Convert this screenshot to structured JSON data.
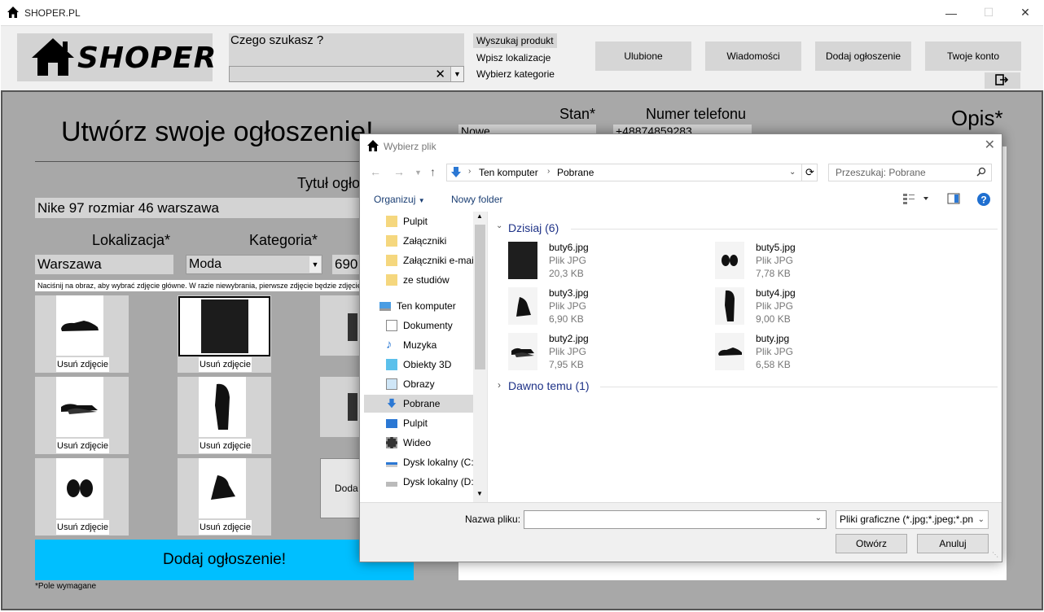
{
  "app": {
    "window_title": "SHOPER.PL",
    "logo_text": "SHOPER"
  },
  "header": {
    "search_query": "Czego szukasz ?",
    "search_product": "Wyszukaj produkt",
    "set_location": "Wpisz lokalizacje",
    "choose_category": "Wybierz kategorie",
    "nav": [
      "Ulubione",
      "Wiadomości",
      "Dodaj ogłoszenie",
      "Twoje konto"
    ]
  },
  "form": {
    "page_title": "Utwórz swoje ogłoszenie!",
    "title_label": "Tytuł ogło",
    "title_value": "Nike 97 rozmiar 46 warszawa",
    "location_label": "Lokalizacja*",
    "location_value": "Warszawa",
    "category_label": "Kategoria*",
    "category_value": "Moda",
    "price_value": "690",
    "state_label": "Stan*",
    "state_value": "Nowe",
    "phone_label": "Numer telefonu",
    "phone_value": "+48874859283",
    "description_label": "Opis*",
    "hint": "Naciśnij na obraz, aby wybrać zdjęcie główne. W razie niewybrania, pierwsze zdjęcie będzie zdjęciem głównym",
    "remove_photo": "Usuń zdjęcie",
    "add_photo": "Doda",
    "submit": "Dodaj ogłoszenie!",
    "required_note": "*Pole wymagane"
  },
  "dialog": {
    "title": "Wybierz plik",
    "breadcrumb": [
      "Ten komputer",
      "Pobrane"
    ],
    "search_placeholder": "Przeszukaj: Pobrane",
    "organize": "Organizuj",
    "new_folder": "Nowy folder",
    "nav_items": [
      {
        "label": "Pulpit",
        "icon": "folder-icon"
      },
      {
        "label": "Załączniki",
        "icon": "folder-icon"
      },
      {
        "label": "Załączniki e-mai",
        "icon": "folder-icon"
      },
      {
        "label": "ze studiów",
        "icon": "folder-icon"
      },
      {
        "label": "Ten komputer",
        "icon": "computer-icon"
      },
      {
        "label": "Dokumenty",
        "icon": "documents-icon"
      },
      {
        "label": "Muzyka",
        "icon": "music-icon"
      },
      {
        "label": "Obiekty 3D",
        "icon": "cube-icon"
      },
      {
        "label": "Obrazy",
        "icon": "pictures-icon"
      },
      {
        "label": "Pobrane",
        "icon": "download-icon"
      },
      {
        "label": "Pulpit",
        "icon": "desktop-icon"
      },
      {
        "label": "Wideo",
        "icon": "video-icon"
      },
      {
        "label": "Dysk lokalny (C:)",
        "icon": "drive-icon"
      },
      {
        "label": "Dysk lokalny (D:)",
        "icon": "drive-icon"
      }
    ],
    "group_today": "Dzisiaj (6)",
    "group_earlier": "Dawno temu (1)",
    "files": [
      {
        "name": "buty6.jpg",
        "type": "Plik JPG",
        "size": "20,3 KB"
      },
      {
        "name": "buty5.jpg",
        "type": "Plik JPG",
        "size": "7,78 KB"
      },
      {
        "name": "buty3.jpg",
        "type": "Plik JPG",
        "size": "6,90 KB"
      },
      {
        "name": "buty4.jpg",
        "type": "Plik JPG",
        "size": "9,00 KB"
      },
      {
        "name": "buty2.jpg",
        "type": "Plik JPG",
        "size": "7,95 KB"
      },
      {
        "name": "buty.jpg",
        "type": "Plik JPG",
        "size": "6,58 KB"
      }
    ],
    "filename_label": "Nazwa pliku:",
    "filename_value": "",
    "filter": "Pliki graficzne (*.jpg;*.jpeg;*.pn",
    "open": "Otwórz",
    "cancel": "Anuluj"
  }
}
